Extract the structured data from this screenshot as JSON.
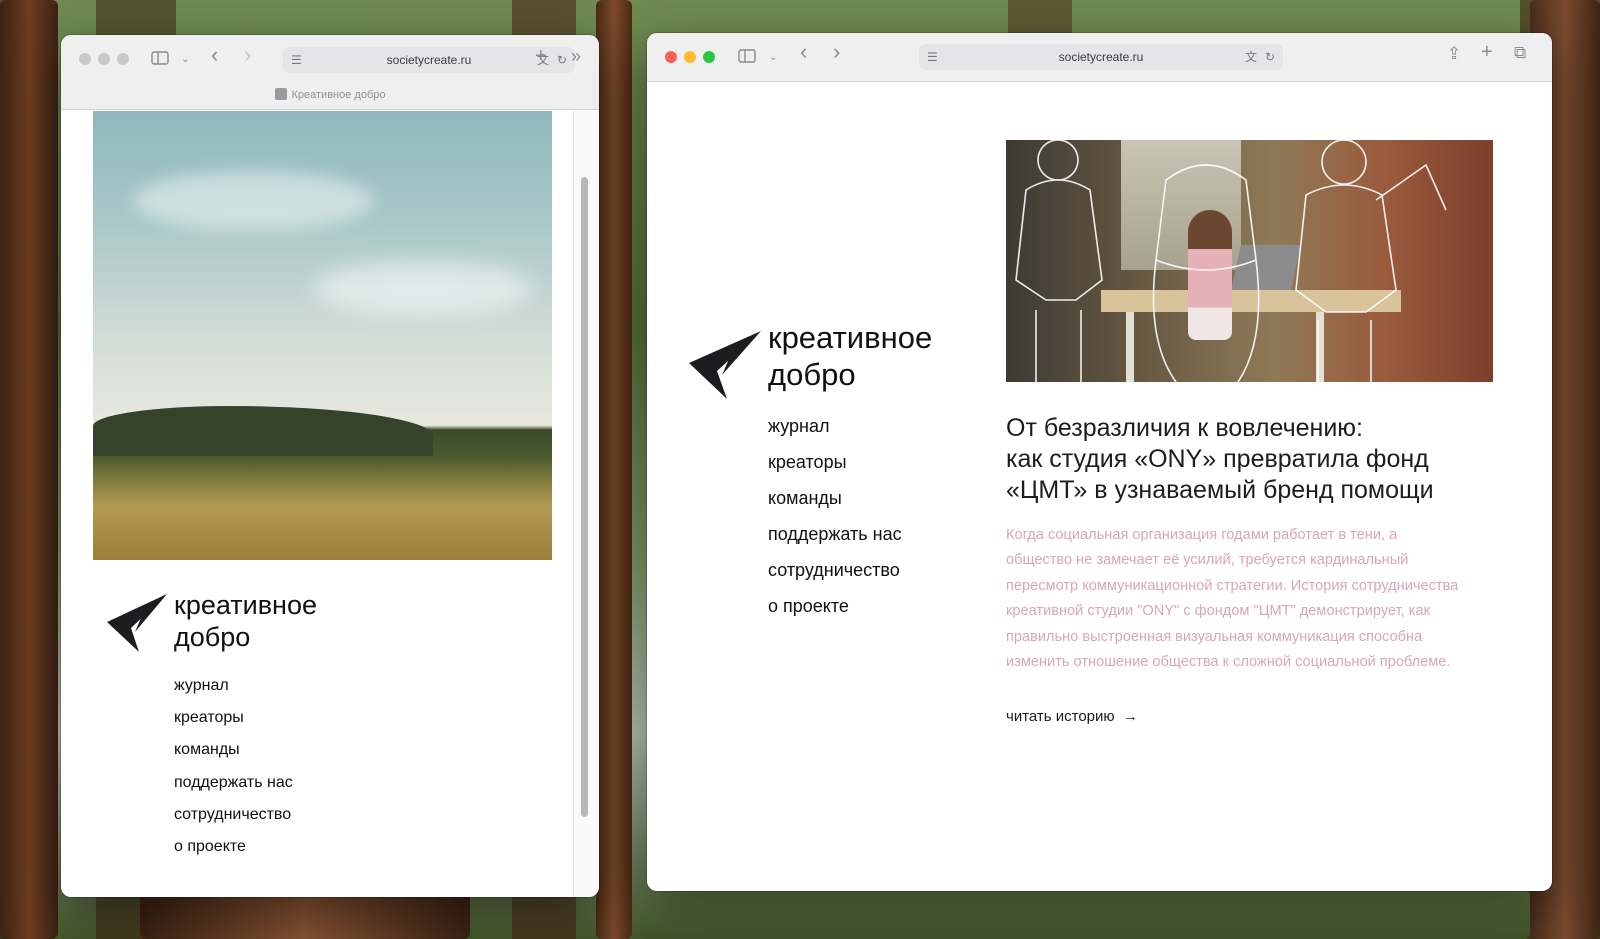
{
  "colors": {
    "accent_pink": "#d7a7b5",
    "text": "#111111"
  },
  "left_window": {
    "url": "societycreate.ru",
    "tab_title": "Креативное добро",
    "brand": {
      "line1": "креативное",
      "line2": "добро"
    },
    "nav": [
      "журнал",
      "креаторы",
      "команды",
      "поддержать нас",
      "сотрудничество",
      "о проекте"
    ]
  },
  "right_window": {
    "url": "societycreate.ru",
    "brand": {
      "line1": "креативное",
      "line2": "добро"
    },
    "nav": [
      "журнал",
      "креаторы",
      "команды",
      "поддержать нас",
      "сотрудничество",
      "о проекте"
    ],
    "article": {
      "title_line1": "От безразличия к вовлечению:",
      "title_line2": "как студия «ONY» превратила фонд",
      "title_line3": "«ЦМТ» в узнаваемый бренд помощи",
      "excerpt": "Когда социальная организация годами работает в тени, а общество не замечает её усилий, требуется кардинальный пересмотр коммуникационной стратегии. История сотрудничества креативной студии \"ONY\" с фондом \"ЦМТ\" демонстрирует, как правильно выстроенная визуальная коммуникация способна изменить отношение общества к сложной социальной проблеме.",
      "read_more": "читать историю",
      "read_more_arrow": "→"
    }
  },
  "icons": {
    "back": "‹",
    "forward": "›",
    "plus": "+",
    "more": "»",
    "reload": "↻",
    "share": "⇪",
    "tabs": "⧉"
  }
}
